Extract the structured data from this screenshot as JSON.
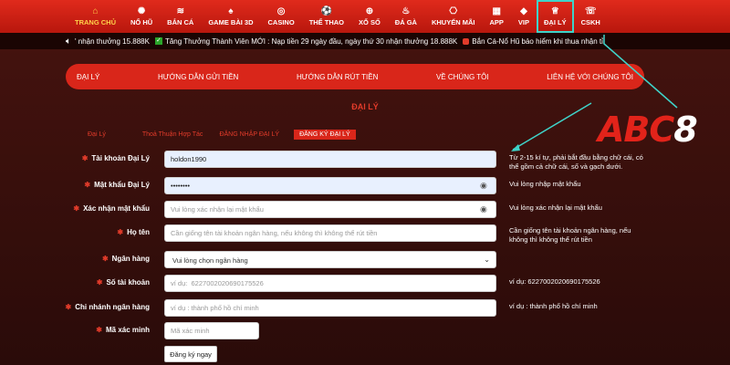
{
  "nav": {
    "items": [
      {
        "label": "TRANG CHỦ",
        "icon": "home-icon",
        "glyph": "⌂"
      },
      {
        "label": "NỔ HŨ",
        "icon": "jackpot-icon",
        "glyph": "✺"
      },
      {
        "label": "BẮN CÁ",
        "icon": "fish-icon",
        "glyph": "≋"
      },
      {
        "label": "GAME BÀI 3D",
        "icon": "cards-icon",
        "glyph": "♠"
      },
      {
        "label": "CASINO",
        "icon": "chip-icon",
        "glyph": "◎"
      },
      {
        "label": "THỂ THAO",
        "icon": "sports-icon",
        "glyph": "⚽"
      },
      {
        "label": "XỔ SỐ",
        "icon": "lottery-icon",
        "glyph": "⊕"
      },
      {
        "label": "ĐÁ GÀ",
        "icon": "rooster-icon",
        "glyph": "♨"
      },
      {
        "label": "KHUYẾN MÃI",
        "icon": "gift-icon",
        "glyph": "⎔"
      },
      {
        "label": "APP",
        "icon": "app-icon",
        "glyph": "▦"
      },
      {
        "label": "VIP",
        "icon": "diamond-icon",
        "glyph": "◆"
      },
      {
        "label": "ĐẠI LÝ",
        "icon": "agent-icon",
        "glyph": "♕"
      },
      {
        "label": "CSKH",
        "icon": "support-icon",
        "glyph": "☏"
      }
    ]
  },
  "ticker": {
    "text1": "' nhận thưởng 15.888K",
    "text2": "Tăng Thưởng Thành Viên MỚI : Nạp tiền 29 ngày đầu, ngày thứ 30 nhận thưởng 18.888K",
    "text3": "Bắn Cá-Nổ Hũ bảo hiểm khi thua nhận tỉ"
  },
  "subnav": {
    "items": [
      "ĐẠI LÝ",
      "HƯỚNG DẪN GỬI TIỀN",
      "HƯỚNG DẪN RÚT TIỀN",
      "VỀ CHÚNG TÔI",
      "LIÊN HỆ VỚI CHÚNG TÔI"
    ]
  },
  "page_title": "ĐẠI LÝ",
  "tabs": [
    "Đại Lý",
    "Thoả Thuận Hợp Tác",
    "ĐĂNG NHẬP ĐẠI LÝ",
    "ĐĂNG KÝ ĐẠI LÝ"
  ],
  "form": {
    "account_label": "Tài khoản Đại Lý",
    "account_value": "holdon1990",
    "account_hint": "Từ 2-15 kí tự, phải bắt đầu bằng chữ cái, có thể gồm cả chữ cái, số và gạch dưới.",
    "password_label": "Mật khẩu Đại Lý",
    "password_value": "••••••••",
    "password_hint": "Vui lòng nhập mật khẩu",
    "confirm_label": "Xác nhận mật khẩu",
    "confirm_placeholder": "Vui lòng xác nhận lại mật khẩu",
    "confirm_hint": "Vui lòng xác nhận lại mật khẩu",
    "name_label": "Họ tên",
    "name_placeholder": "Cần giống tên tài khoản ngân hàng, nếu không thì không thể rút tiền",
    "name_hint": "Cần giống tên tài khoản ngân hàng, nếu không thì không thể rút tiền",
    "bank_label": "Ngân hàng",
    "bank_selected": "Vui lòng chọn ngân hàng",
    "acct_no_label": "Số tài khoản",
    "acct_no_placeholder": "ví dụ:  6227002020690175526",
    "acct_no_hint": "ví dụ:   6227002020690175526",
    "branch_label": "Chi nhánh ngân hàng",
    "branch_placeholder": "ví dụ : thành phố hồ chí minh",
    "branch_hint": "ví dụ : thành phố hồ chí minh",
    "captcha_label": "Mã xác minh",
    "captcha_placeholder": "Mã xác minh",
    "submit_label": "Đăng ký ngay"
  },
  "logo": {
    "part1": "ABC",
    "part2": "8"
  },
  "colors": {
    "brand_red": "#d9261a",
    "accent_gold": "#ffd24a",
    "annotation_teal": "#3fd3c9",
    "bg_dark": "#3a0f0c"
  }
}
